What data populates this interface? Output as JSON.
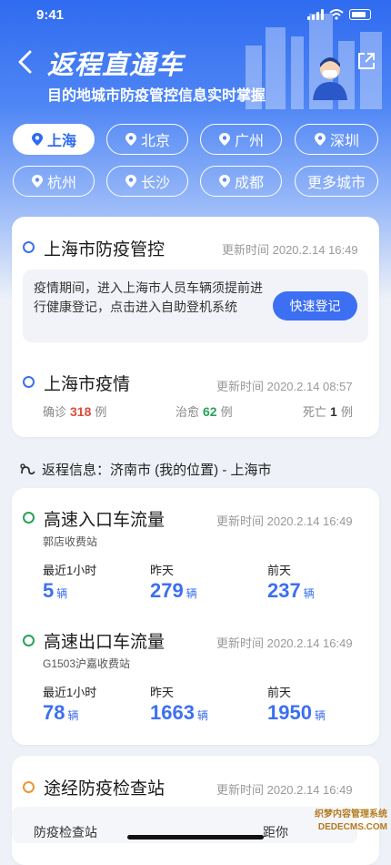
{
  "status": {
    "time": "9:41"
  },
  "header": {
    "title": "返程直通车",
    "subtitle": "目的地城市防疫管控信息实时掌握"
  },
  "cities": [
    {
      "name": "上海",
      "active": true
    },
    {
      "name": "北京",
      "active": false
    },
    {
      "name": "广州",
      "active": false
    },
    {
      "name": "深圳",
      "active": false
    },
    {
      "name": "杭州",
      "active": false
    },
    {
      "name": "长沙",
      "active": false
    },
    {
      "name": "成都",
      "active": false
    }
  ],
  "more_cities": "更多城市",
  "control": {
    "title": "上海市防疫管控",
    "updated": "更新时间 2020.2.14 16:49",
    "notice": "疫情期间，进入上海市人员车辆须提前进行健康登记，点击进入自助登机系统",
    "button": "快速登记"
  },
  "epidemic": {
    "title": "上海市疫情",
    "updated": "更新时间 2020.2.14 08:57",
    "confirmed_label": "确诊",
    "confirmed": "318",
    "confirmed_unit": "例",
    "cured_label": "治愈",
    "cured": "62",
    "cured_unit": "例",
    "death_label": "死亡",
    "death": "1",
    "death_unit": "例"
  },
  "route": {
    "text": "返程信息：济南市 (我的位置) - 上海市"
  },
  "entry_flow": {
    "title": "高速入口车流量",
    "updated": "更新时间 2020.2.14 16:49",
    "station": "郭店收费站",
    "labels": [
      "最近1小时",
      "昨天",
      "前天"
    ],
    "values": [
      "5",
      "279",
      "237"
    ],
    "unit": "辆"
  },
  "exit_flow": {
    "title": "高速出口车流量",
    "updated": "更新时间 2020.2.14 16:49",
    "station": "G1503沪嘉收费站",
    "labels": [
      "最近1小时",
      "昨天",
      "前天"
    ],
    "values": [
      "78",
      "1663",
      "1950"
    ],
    "unit": "辆"
  },
  "checkpoint": {
    "title": "途经防疫检查站",
    "updated": "更新时间 2020.2.14 16:49",
    "col1": "防疫检查站",
    "col2": "距你"
  },
  "watermark": {
    "line1": "织梦内容管理系统",
    "line2": "DEDECMS.COM"
  },
  "colors": {
    "primary": "#3c6ff2",
    "confirmed": "#e04a3a",
    "cured": "#2aa15a",
    "text": "#1a1a1a"
  }
}
